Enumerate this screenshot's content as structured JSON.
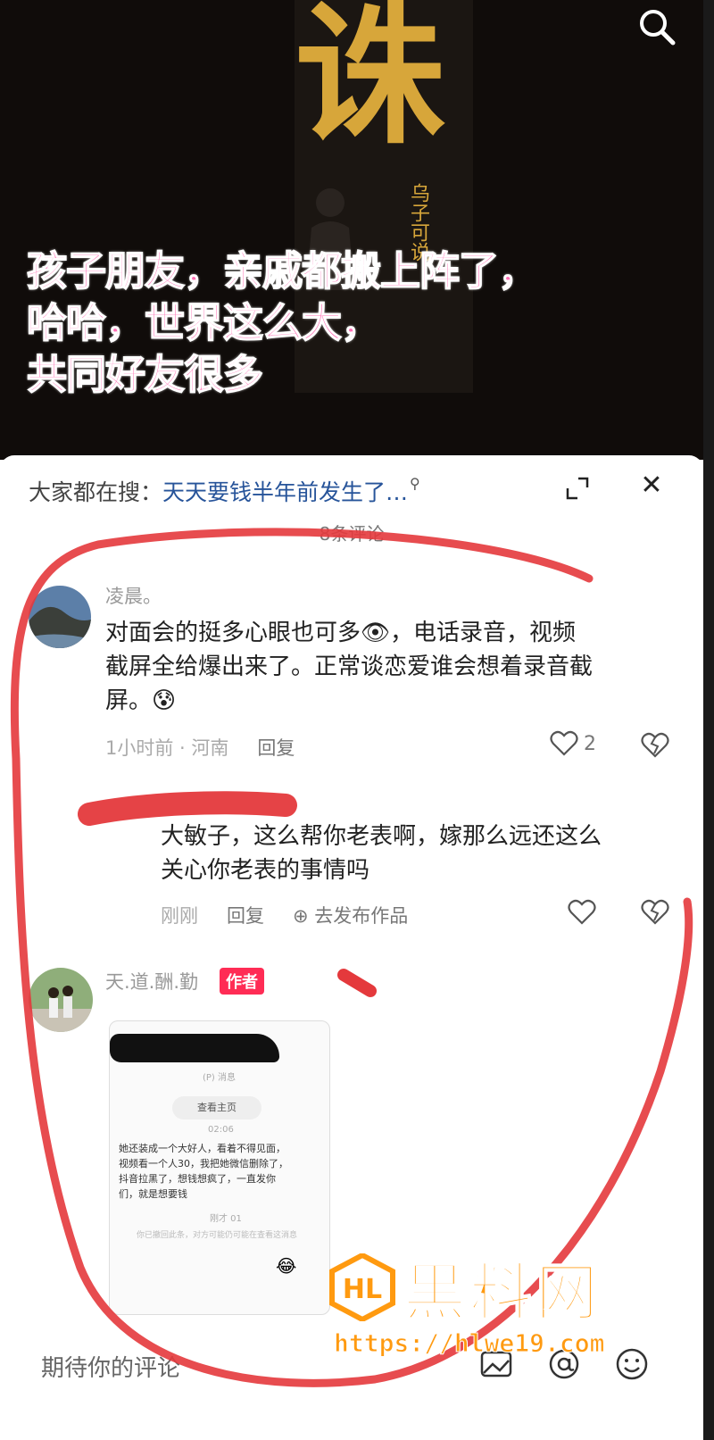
{
  "video": {
    "calligraphy": "诛",
    "calligraphy_side": "乌子可说",
    "overlay_lines": [
      "孩子朋友，亲戚都搬上阵了，",
      "哈哈，世界这么大，",
      "共同好友很多"
    ]
  },
  "sheet": {
    "suggest_prefix": "大家都在搜：",
    "suggest_query": "天天要钱半年前发生了…",
    "comment_count": "8条评论"
  },
  "comments": [
    {
      "name": "凌晨。",
      "text_line1": "对面会的挺多心眼也可多👁，电话录音，视频",
      "text_line2": "截屏全给爆出来了。正常谈恋爱谁会想着录音截",
      "text_line3": "屏。😰",
      "time": "1小时前 · 河南",
      "reply": "回复",
      "likes": "2"
    }
  ],
  "reply": {
    "text_line1": "大敏子，这么帮你老表啊，嫁那么远还这么",
    "text_line2": "关心你老表的事情吗",
    "time": "刚刚",
    "reply": "回复",
    "publish": "去发布作品"
  },
  "author_comment": {
    "name": "天.道.酬.勤",
    "badge": "作者",
    "screenshot": {
      "header": "(P) 消息",
      "chip": "查看主页",
      "time1": "02:06",
      "message": "她还装成一个大好人，看着不得见面，视频看一个人30，我把她微信删除了，抖音拉黑了，想钱想疯了，一直发你们，就是想要钱",
      "time2": "刚才 01",
      "system": "你已撤回此条，对方可能仍可能在查看这消息",
      "emoji": "😂"
    }
  },
  "input": {
    "placeholder": "期待你的评论"
  },
  "watermark": {
    "title": "黑料网",
    "url": "https://hlwe19.com"
  },
  "colors": {
    "overlay_pink": "#ff6fb5",
    "gold": "#d7a63a",
    "link_blue": "#27549a",
    "author_red": "#ff2c55",
    "mark_red": "#e4393c",
    "watermark_orange": "#ff9a10"
  }
}
